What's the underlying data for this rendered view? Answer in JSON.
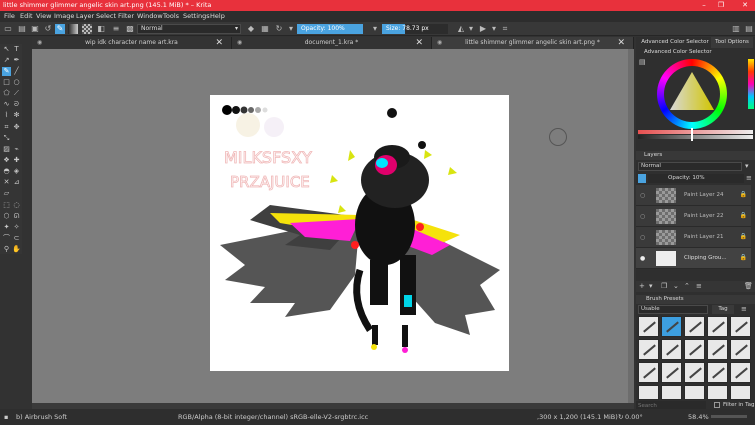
{
  "window": {
    "title": "little shimmer glimmer angelic skin art.png (145.1 MiB)  * – Krita",
    "minimize": "–",
    "maximize": "❐",
    "close": "✕"
  },
  "menu": [
    "File",
    "Edit",
    "View",
    "Image",
    "Layer",
    "Select",
    "Filter",
    "Window",
    "Tools",
    "Settings",
    "Help"
  ],
  "toolbar": {
    "blend_mode": "Normal",
    "opacity_label": "Opacity: 100%",
    "opacity_value": 100,
    "size_label": "Size: ",
    "size_value": "78.73 px",
    "size_fill": 0.35
  },
  "tabs": [
    {
      "label": "wip idk character name art.kra",
      "close": "✕"
    },
    {
      "label": "document_1.kra *",
      "close": "✕"
    },
    {
      "label": "little shimmer glimmer angelic skin art.png *",
      "close": "✕"
    }
  ],
  "canvas_art": {
    "text_line1": "MILKSFSXY",
    "text_line2": "PRZAJUICE"
  },
  "dock": {
    "tab_color_selector": "Advanced Color Selector",
    "tab_tool_options": "Tool Options",
    "color_selector_title": "Advanced Color Selector",
    "layers_title": "Layers",
    "layers_blend": "Normal",
    "layers_opacity": "Opacity:  10%",
    "layers": [
      {
        "name": "Paint Layer 24"
      },
      {
        "name": "Paint Layer 22"
      },
      {
        "name": "Paint Layer 21"
      },
      {
        "name": "Clipping Grou..."
      }
    ],
    "brush_presets_title": "Brush Presets",
    "brush_tag": "Usable",
    "tag_button": "Tag",
    "search_placeholder": "Search",
    "filter_in_tag": "Filter in Tag"
  },
  "status": {
    "brush": "b) Airbrush Soft",
    "color_model": "RGB/Alpha (8-bit integer/channel)  sRGB-elle-V2-srgbtrc.icc",
    "dimensions": ",300 x 1,200 (145.1 MiB)",
    "rotation": "0.00°",
    "zoom": "58.4%"
  },
  "colors": {
    "titlebar": "#e8313c",
    "accent": "#4aa3e0"
  }
}
